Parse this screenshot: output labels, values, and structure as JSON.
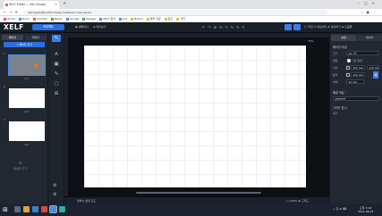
{
  "browser": {
    "tab_title": "XELF Editor — Ink Canvas",
    "url": "xelf.app/editor/ink?mode=edit&doc=canvas-01",
    "bookmarks": [
      {
        "label": "Gmail",
        "color": "r"
      },
      {
        "label": "Drive",
        "color": ""
      },
      {
        "label": "Youtube",
        "color": "r"
      },
      {
        "label": "Naver",
        "color": "g"
      },
      {
        "label": "Google",
        "color": ""
      },
      {
        "label": "Papago",
        "color": "g"
      },
      {
        "label": "XELF 문서",
        "color": ""
      },
      {
        "label": "Jira",
        "color": ""
      },
      {
        "label": "Notion",
        "color": "y"
      },
      {
        "label": "업무 자료",
        "color": "y"
      },
      {
        "label": "참고",
        "color": "y"
      },
      {
        "label": "기타",
        "color": "y"
      }
    ]
  },
  "header": {
    "logo": "XELF",
    "project_button": "프로젝트",
    "left_items": [
      "◉ 새페이지",
      "⊕ 미리보기"
    ],
    "tools": [
      "↶",
      "↷",
      "⊞",
      "⊟",
      "✎",
      "✎",
      "✎",
      "✎"
    ],
    "right_items": [
      "◯ 저장",
      "⊡ 내보내기",
      "⊕ 공유하기",
      "⊞ 도움말"
    ]
  },
  "left_panel": {
    "tabs": [
      "페이지",
      "레이어"
    ],
    "add_button": "+ 페이지 추가",
    "pages": [
      {
        "num": "1",
        "label": "1/4"
      },
      {
        "num": "2",
        "label": "2/4"
      },
      {
        "num": "3",
        "label": "3/4"
      }
    ],
    "add_page_icon": "+",
    "add_page_label": "페이지 추가"
  },
  "tools": [
    "↖",
    "A",
    "▣",
    "✎",
    "▢",
    "⊞"
  ],
  "bottom_tools": [
    "⚙",
    "⊕"
  ],
  "canvas": {
    "zoom": "75%",
    "status_left": "캔버스 편집 모드",
    "status_right": "□ 100%   ⊞ 그리드"
  },
  "right_panel": {
    "tabs": [
      "속성",
      "레이어"
    ],
    "section_title": "페이지 속성",
    "fields": [
      {
        "label": "크기",
        "value": "A4 가로"
      },
      {
        "label": "방향",
        "value": "가로"
      },
      {
        "label": "너비",
        "value": "297 mm"
      },
      {
        "label": "높이",
        "value": "210 mm"
      },
      {
        "label": "여백",
        "value": "10 mm"
      }
    ],
    "orientation_label": "가로 방향",
    "background_section": "배경 색상",
    "background_value": "#FFFFFF",
    "grid_section": "그리드 표시",
    "grid_value": "켜기"
  },
  "taskbar": {
    "tray": "ㅅ 한 ⊕ ⌨",
    "time": "오후 3:12",
    "date": "2021-06-23"
  },
  "colors": {
    "accent": "#3c7cf0",
    "header_bg": "#1a2028",
    "panel_bg": "#222831",
    "canvas_bg": "#0c0f14"
  }
}
